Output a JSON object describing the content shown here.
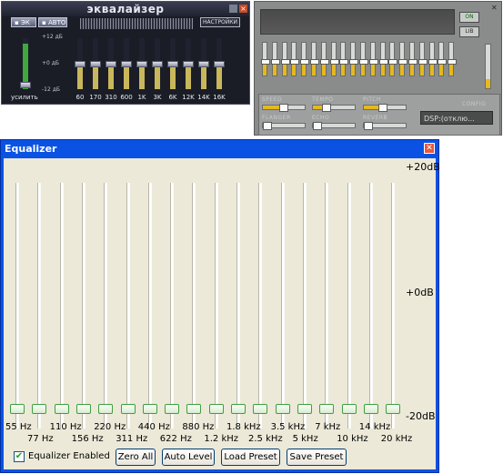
{
  "winamp": {
    "title": "эквалайзер",
    "eq_button": "ЭК",
    "auto_button": "АВТО",
    "settings_button": "НАСТРОЙКИ",
    "preamp_label": "усилить",
    "db_top": "+12 дБ",
    "db_mid": "+0 дБ",
    "db_bot": "-12 дБ",
    "freqs": [
      "60",
      "170",
      "310",
      "600",
      "1K",
      "3K",
      "6K",
      "12K",
      "14K",
      "16K"
    ]
  },
  "gray": {
    "on_label": "ON",
    "lib_label": "LIB",
    "speed_label": "SPEED",
    "tempo_label": "TEMPO",
    "pitch_label": "PITCH",
    "flanger_label": "FLANGER",
    "echo_label": "ECHO",
    "reverb_label": "REVERB",
    "config_label": "CONFIG",
    "dsp_value": "DSP:(отклю..."
  },
  "dialog": {
    "title": "Equalizer",
    "db_top": "+20dB",
    "db_mid": "+0dB",
    "db_bot": "-20dB",
    "freqs_row1": [
      "55 Hz",
      "110 Hz",
      "220 Hz",
      "440 Hz",
      "880 Hz",
      "1.8 kHz",
      "3.5 kHz",
      "7 kHz",
      "14 kHz"
    ],
    "freqs_row2": [
      "77 Hz",
      "156 Hz",
      "311 Hz",
      "622 Hz",
      "1.2 kHz",
      "2.5 kHz",
      "5 kHz",
      "10 kHz",
      "20 kHz"
    ],
    "enabled_label": "Equalizer Enabled",
    "enabled_checked": true,
    "zero_all": "Zero All",
    "auto_level": "Auto Level",
    "load_preset": "Load Preset",
    "save_preset": "Save Preset"
  }
}
